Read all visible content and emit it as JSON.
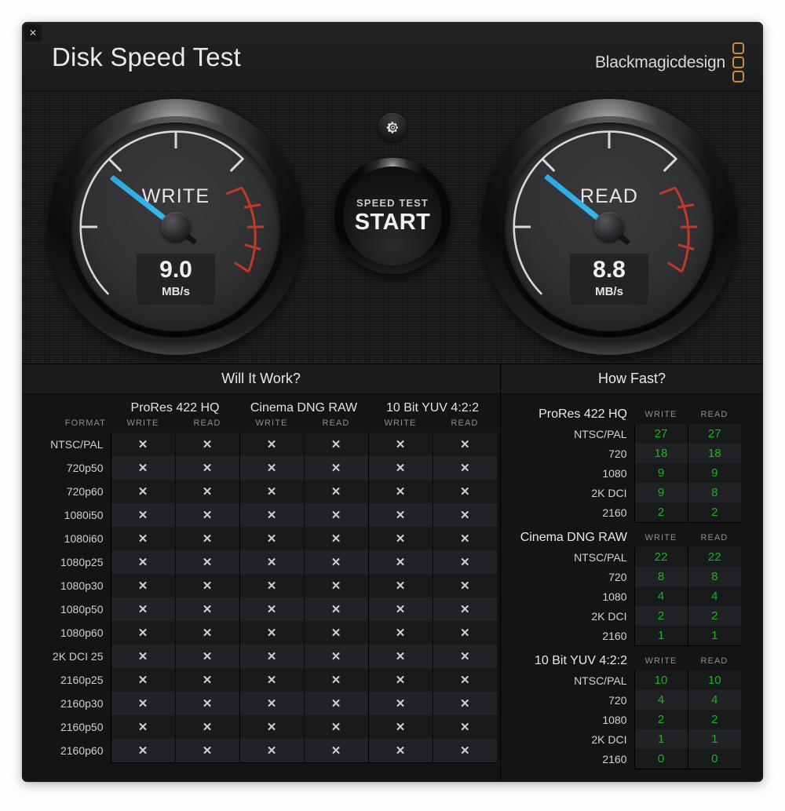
{
  "window": {
    "title": "Disk Speed Test",
    "close_label": "✕",
    "brand": "Blackmagicdesign"
  },
  "gauges": {
    "write": {
      "label": "WRITE",
      "value": "9.0",
      "unit": "MB/s",
      "needle_deg": 218
    },
    "read": {
      "label": "READ",
      "value": "8.8",
      "unit": "MB/s",
      "needle_deg": 219
    }
  },
  "controls": {
    "gear_icon": "gear-icon",
    "start_sub": "SPEED TEST",
    "start_main": "START"
  },
  "colors": {
    "accent_needle": "#2da8e0",
    "brand_orange": "#c58f3a",
    "value_green": "#19b418",
    "panel_bg": "#141416"
  },
  "will_it_work": {
    "title": "Will It Work?",
    "format_header": "FORMAT",
    "groups": [
      "ProRes 422 HQ",
      "Cinema DNG RAW",
      "10 Bit YUV 4:2:2"
    ],
    "sub_headers": [
      "WRITE",
      "READ"
    ],
    "mark": "✕",
    "rows": [
      {
        "format": "NTSC/PAL",
        "cells": [
          "✕",
          "✕",
          "✕",
          "✕",
          "✕",
          "✕"
        ]
      },
      {
        "format": "720p50",
        "cells": [
          "✕",
          "✕",
          "✕",
          "✕",
          "✕",
          "✕"
        ]
      },
      {
        "format": "720p60",
        "cells": [
          "✕",
          "✕",
          "✕",
          "✕",
          "✕",
          "✕"
        ]
      },
      {
        "format": "1080i50",
        "cells": [
          "✕",
          "✕",
          "✕",
          "✕",
          "✕",
          "✕"
        ]
      },
      {
        "format": "1080i60",
        "cells": [
          "✕",
          "✕",
          "✕",
          "✕",
          "✕",
          "✕"
        ]
      },
      {
        "format": "1080p25",
        "cells": [
          "✕",
          "✕",
          "✕",
          "✕",
          "✕",
          "✕"
        ]
      },
      {
        "format": "1080p30",
        "cells": [
          "✕",
          "✕",
          "✕",
          "✕",
          "✕",
          "✕"
        ]
      },
      {
        "format": "1080p50",
        "cells": [
          "✕",
          "✕",
          "✕",
          "✕",
          "✕",
          "✕"
        ]
      },
      {
        "format": "1080p60",
        "cells": [
          "✕",
          "✕",
          "✕",
          "✕",
          "✕",
          "✕"
        ]
      },
      {
        "format": "2K DCI 25",
        "cells": [
          "✕",
          "✕",
          "✕",
          "✕",
          "✕",
          "✕"
        ]
      },
      {
        "format": "2160p25",
        "cells": [
          "✕",
          "✕",
          "✕",
          "✕",
          "✕",
          "✕"
        ]
      },
      {
        "format": "2160p30",
        "cells": [
          "✕",
          "✕",
          "✕",
          "✕",
          "✕",
          "✕"
        ]
      },
      {
        "format": "2160p50",
        "cells": [
          "✕",
          "✕",
          "✕",
          "✕",
          "✕",
          "✕"
        ]
      },
      {
        "format": "2160p60",
        "cells": [
          "✕",
          "✕",
          "✕",
          "✕",
          "✕",
          "✕"
        ]
      }
    ]
  },
  "how_fast": {
    "title": "How Fast?",
    "sub_headers": [
      "WRITE",
      "READ"
    ],
    "groups": [
      {
        "name": "ProRes 422 HQ",
        "rows": [
          {
            "label": "NTSC/PAL",
            "write": "27",
            "read": "27"
          },
          {
            "label": "720",
            "write": "18",
            "read": "18"
          },
          {
            "label": "1080",
            "write": "9",
            "read": "9"
          },
          {
            "label": "2K DCI",
            "write": "9",
            "read": "8"
          },
          {
            "label": "2160",
            "write": "2",
            "read": "2"
          }
        ]
      },
      {
        "name": "Cinema DNG RAW",
        "rows": [
          {
            "label": "NTSC/PAL",
            "write": "22",
            "read": "22"
          },
          {
            "label": "720",
            "write": "8",
            "read": "8"
          },
          {
            "label": "1080",
            "write": "4",
            "read": "4"
          },
          {
            "label": "2K DCI",
            "write": "2",
            "read": "2"
          },
          {
            "label": "2160",
            "write": "1",
            "read": "1"
          }
        ]
      },
      {
        "name": "10 Bit YUV 4:2:2",
        "rows": [
          {
            "label": "NTSC/PAL",
            "write": "10",
            "read": "10"
          },
          {
            "label": "720",
            "write": "4",
            "read": "4"
          },
          {
            "label": "1080",
            "write": "2",
            "read": "2"
          },
          {
            "label": "2K DCI",
            "write": "1",
            "read": "1"
          },
          {
            "label": "2160",
            "write": "0",
            "read": "0"
          }
        ]
      }
    ]
  }
}
